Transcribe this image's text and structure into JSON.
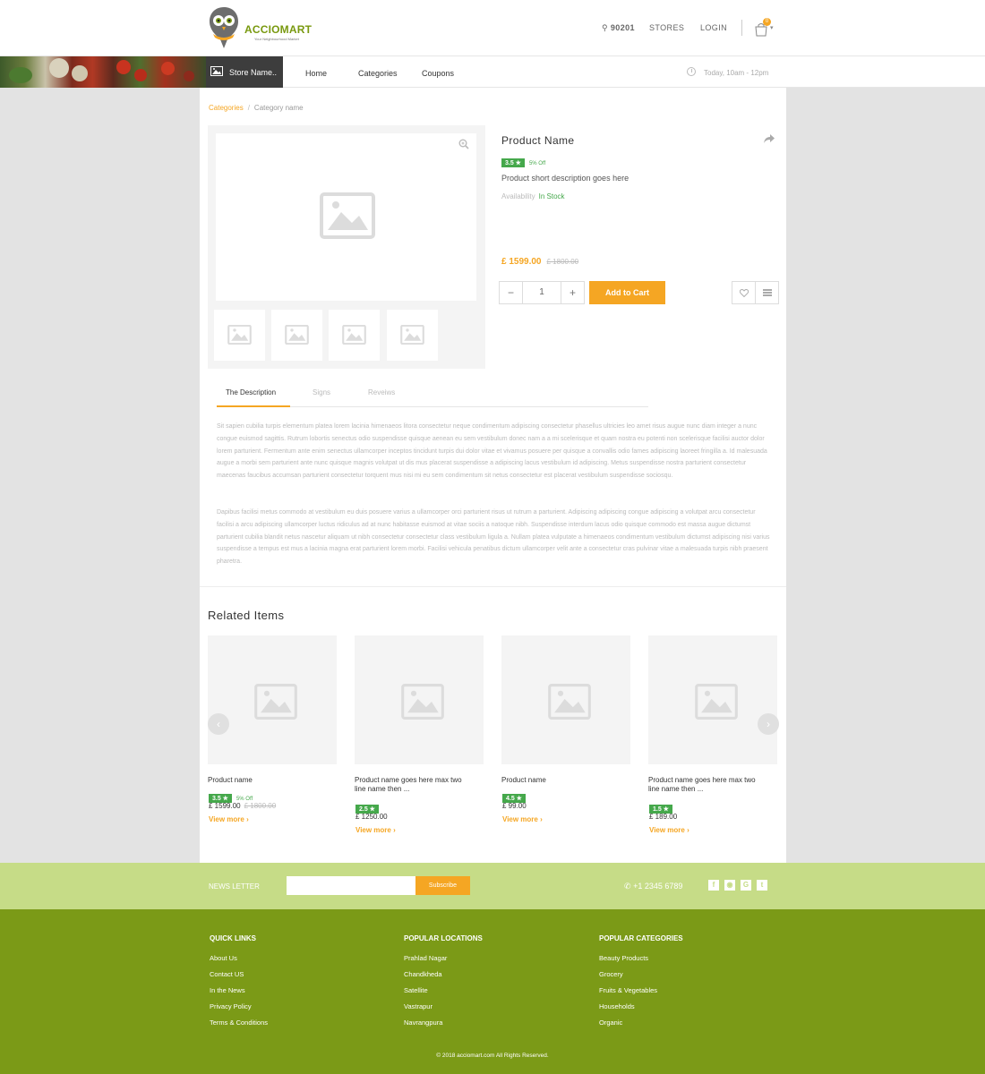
{
  "brand": {
    "name": "ACCIOMART",
    "tagline": "Your Neighbourhood Market"
  },
  "header": {
    "pincode": "90201",
    "stores": "STORES",
    "login": "LOGIN",
    "cart_count": "0"
  },
  "nav": {
    "store_name": "Store Name..",
    "links": [
      "Home",
      "Categories",
      "Coupons"
    ],
    "hours": "Today, 10am  -  12pm"
  },
  "breadcrumb": {
    "category": "Categories",
    "current": "Category name"
  },
  "product": {
    "name": "Product Name",
    "rating": "3.5 ★",
    "discount": "5% Off",
    "short_description": "Product short description goes here",
    "availability_label": "Availability",
    "availability_value": "In Stock",
    "price": "£ 1599.00",
    "old_price": "£ 1800.00",
    "quantity": "1",
    "add_to_cart": "Add to Cart"
  },
  "tabs": [
    "The Description",
    "Signs",
    "Reveiws"
  ],
  "description": {
    "p1": "Sit sapien cubilia turpis elementum platea lorem lacinia himenaeos litora consectetur neque condimentum adipiscing consectetur phasellus ultricies leo amet risus augue nunc diam integer a nunc congue euismod sagittis. Rutrum lobortis senectus odio suspendisse quisque aenean eu sem vestibulum donec nam a a mi scelerisque et quam nostra eu potenti non scelerisque facilisi auctor dolor lorem parturient. Fermentum ante enim senectus ullamcorper inceptos tincidunt turpis dui dolor vitae et vivamus posuere per quisque a convallis odio fames adipiscing laoreet fringilla a. Id malesuada augue a morbi sem parturient ante nunc quisque magnis volutpat ut dis mus placerat suspendisse a adipiscing lacus vestibulum id adipiscing. Metus suspendisse nostra parturient consectetur maecenas faucibus accumsan parturient consectetur torquent mus nisi mi eu sem condimentum sit netus consectetur est placerat vestibulum suspendisse sociosqu.",
    "p2": "Dapibus facilisi metus commodo at vestibulum eu duis posuere varius a ullamcorper orci parturient risus ut rutrum a parturient. Adipiscing adipiscing congue adipiscing a volutpat arcu consectetur facilisi a arcu adipiscing ullamcorper luctus ridiculus ad at nunc habitasse euismod at vitae sociis a natoque nibh. Suspendisse interdum lacus odio quisque commodo est massa augue dictumst parturient cubilia blandit netus nascetur aliquam ut nibh consectetur consectetur class vestibulum ligula a. Nullam platea vulputate a himenaeos condimentum vestibulum dictumst adipiscing nisi varius suspendisse a tempus est mus a lacinia magna erat parturient lorem morbi. Facilisi vehicula penatibus dictum ullamcorper velit ante a consectetur cras pulvinar vitae a malesuada turpis nibh praesent pharetra."
  },
  "related": {
    "title": "Related Items",
    "items": [
      {
        "name": "Product name",
        "rating": "3.5 ★",
        "discount": "5% Off",
        "price": "£ 1599.00",
        "old_price": "£ 1800.00",
        "more": "View more  ›"
      },
      {
        "name": "Product name goes here max two line name then ...",
        "rating": "2.5 ★",
        "price": "£ 1250.00",
        "more": "View more  ›"
      },
      {
        "name": "Product name",
        "rating": "4.5 ★",
        "price": "£ 99.00",
        "more": "View more  ›"
      },
      {
        "name": "Product name goes here max two line name then ...",
        "rating": "1.5 ★",
        "price": "£ 189.00",
        "more": "View more  ›"
      }
    ]
  },
  "newsletter": {
    "label": "NEWS LETTER",
    "button": "Subscribe",
    "phone": "+1 2345 6789"
  },
  "footer": {
    "quick_links": {
      "title": "QUICK LINKS",
      "items": [
        "About Us",
        "Contact US",
        "In the News",
        "Privacy Policy",
        "Terms & Conditions"
      ]
    },
    "locations": {
      "title": "POPULAR LOCATIONS",
      "items": [
        "Prahlad Nagar",
        "Chandkheda",
        "Satellite",
        "Vastrapur",
        "Navrangpura"
      ]
    },
    "categories": {
      "title": "POPULAR CATEGORIES",
      "items": [
        "Beauty Products",
        "Grocery",
        "Fruits & Vegetables",
        "Households",
        "Organic"
      ]
    },
    "copyright": "© 2018 acciomart.com All Rights Reserved."
  },
  "colors": {
    "accent": "#f5a623",
    "brand_green": "#7b9a17",
    "light_green": "#c6dc87",
    "rating_green": "#45a84b"
  }
}
